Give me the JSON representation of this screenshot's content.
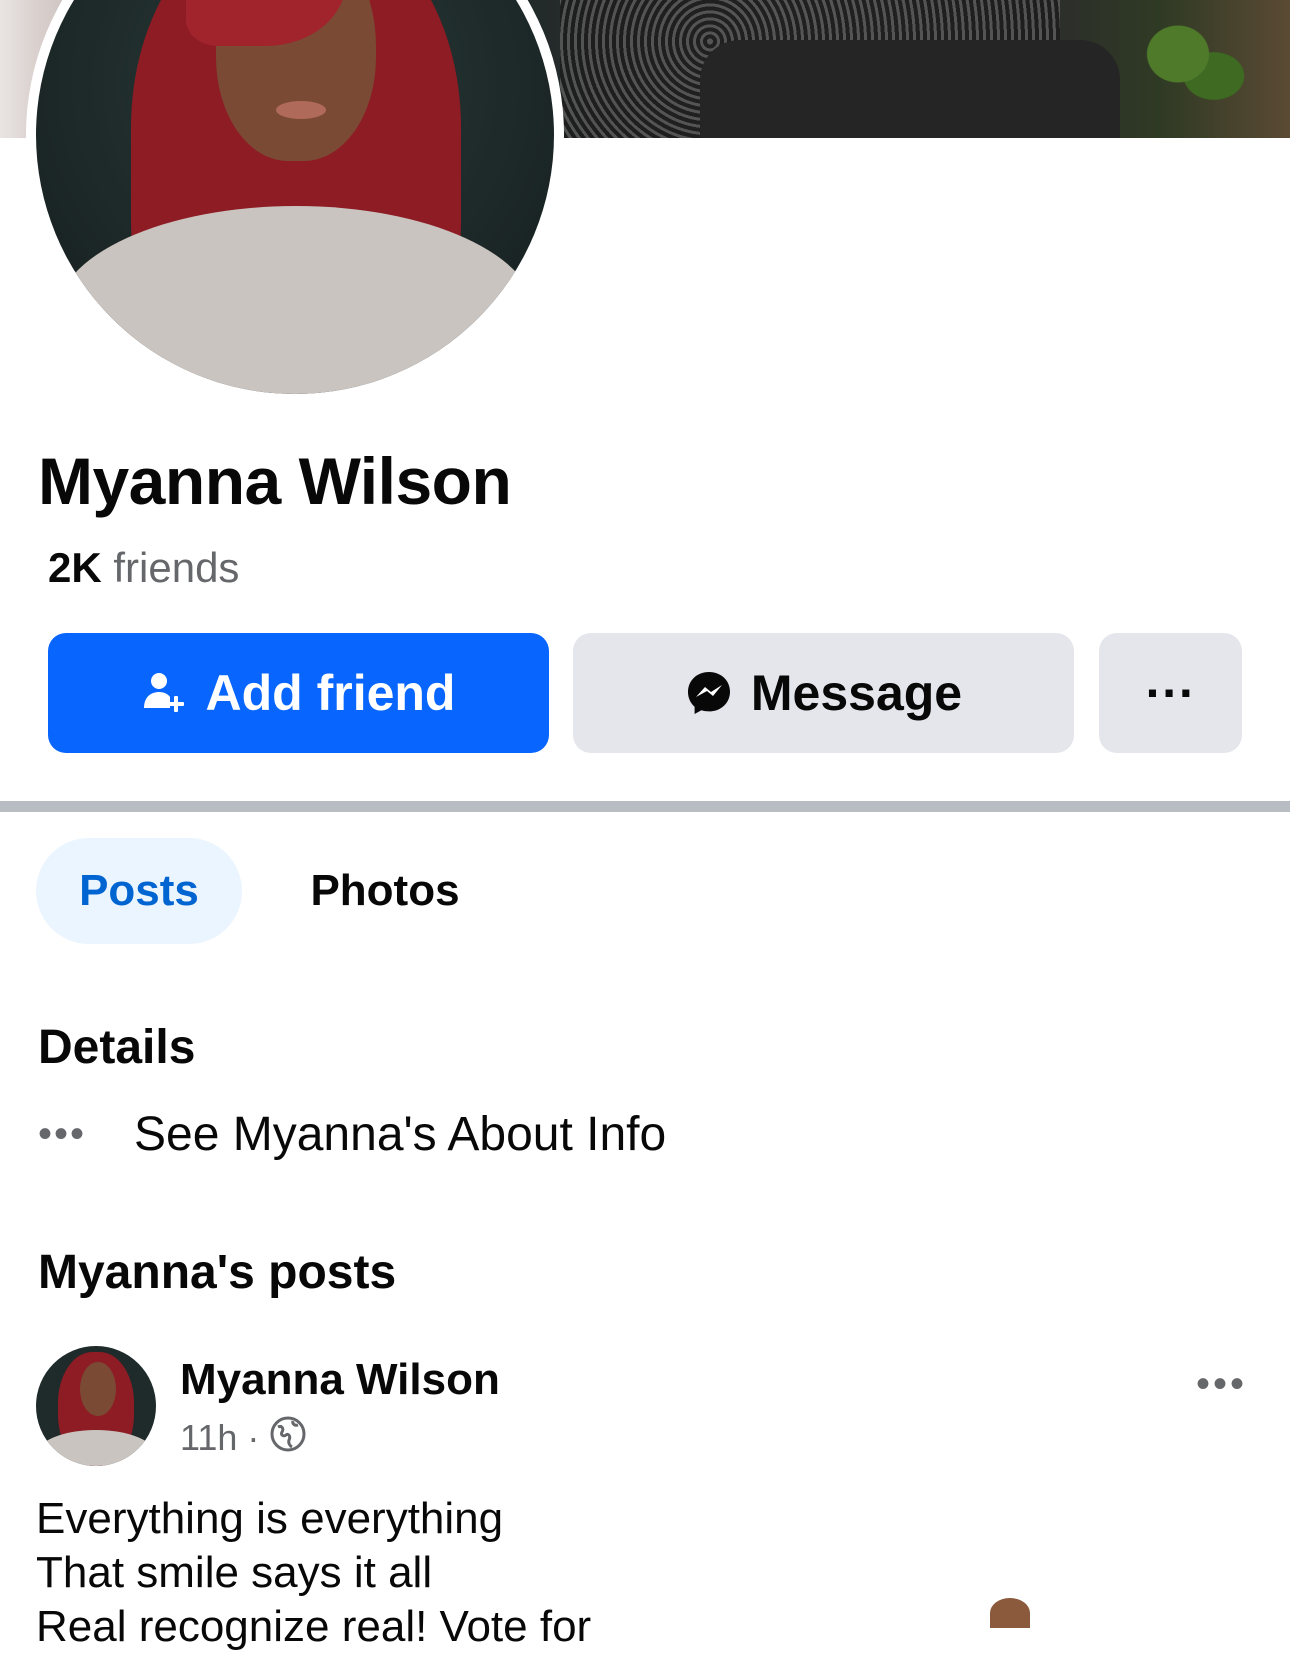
{
  "profile": {
    "name": "Myanna Wilson",
    "friends_count": "2K",
    "friends_label": "friends"
  },
  "actions": {
    "add_friend": "Add friend",
    "message": "Message",
    "more": "···"
  },
  "tabs": [
    {
      "label": "Posts",
      "active": true
    },
    {
      "label": "Photos",
      "active": false
    }
  ],
  "details": {
    "title": "Details",
    "about_link": "See Myanna's About Info"
  },
  "posts_section": {
    "title": "Myanna's posts"
  },
  "post": {
    "author": "Myanna Wilson",
    "time": "11h",
    "separator": "·",
    "audience_icon": "globe-icon",
    "lines": [
      "Everything is everything",
      "That smile says it all",
      "Real recognize real! Vote for"
    ]
  },
  "colors": {
    "primary": "#0866ff",
    "secondary_button": "#e4e6eb",
    "active_tab_bg": "#ebf5ff",
    "active_tab_text": "#0064d1",
    "muted_text": "#65676b"
  }
}
